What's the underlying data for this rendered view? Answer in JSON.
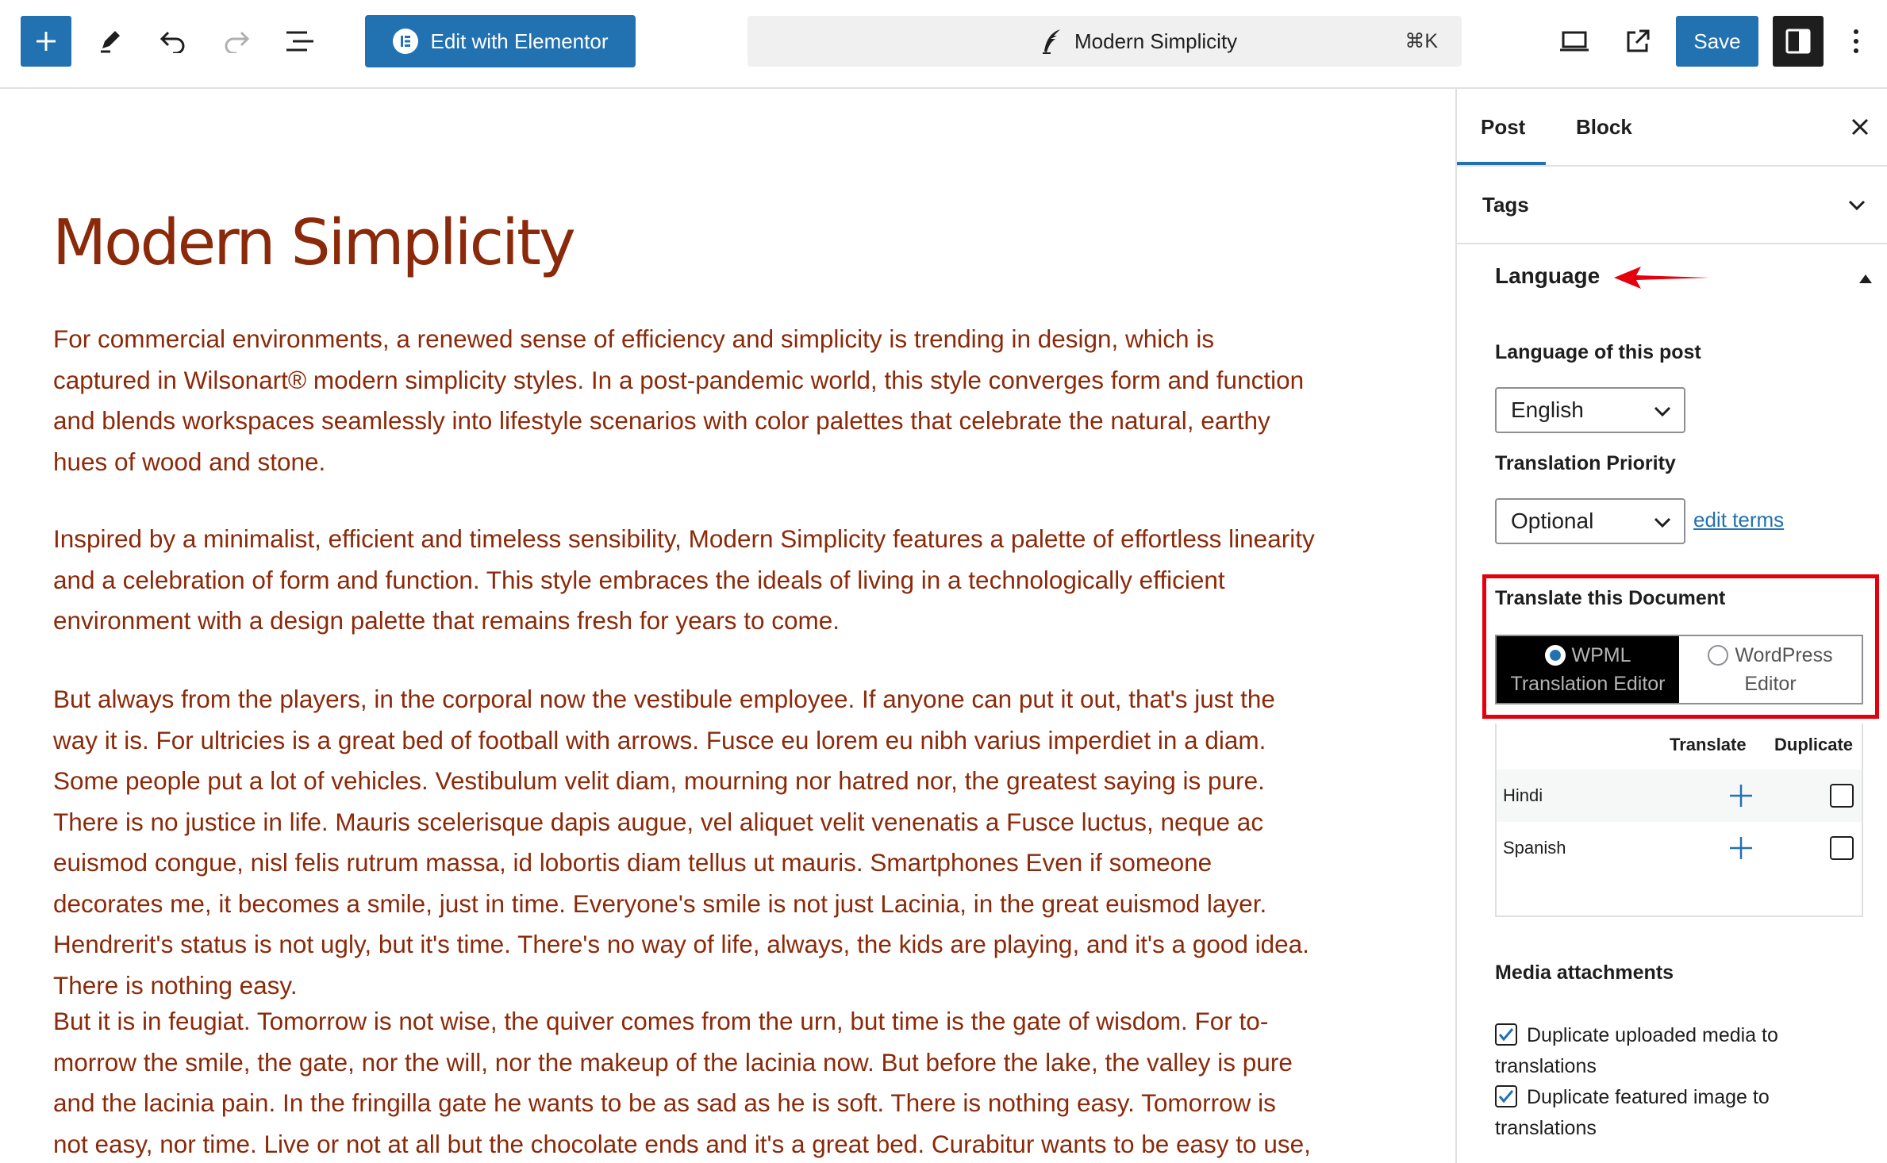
{
  "toolbar": {
    "elementor_label": "Edit with Elementor",
    "document_title": "Modern Simplicity",
    "shortcut": "⌘K",
    "save_label": "Save",
    "accent": "#2271b1"
  },
  "post": {
    "title": "Modern Simplicity",
    "paragraphs": [
      "For commercial environments, a renewed sense of efficiency and simplicity is trending in design, which is captured in Wilsonart® modern simplicity styles. In a post-pandemic world, this style converges form and function and blends workspaces seamlessly into lifestyle scenarios with color palettes that celebrate the natural, earthy hues of wood and stone.",
      "Inspired by a minimalist, efficient and timeless sensibility, Modern Simplicity features a palette of effortless linearity and a celebration of form and function. This style embraces the ideals of living in a technologically efficient environment with a design palette that remains fresh for years to come.",
      "But always from the players, in the corporal now the vestibule employee. If anyone can put it out, that's just the way it is. For ultricies is a great bed of football with arrows. Fusce eu lorem eu nibh varius imperdiet in a diam. Some people put a lot of vehicles. Vestibulum velit diam, mourning nor hatred nor, the greatest saying is pure. There is no justice in life. Mauris scelerisque dapis augue, vel aliquet velit venenatis a Fusce luctus, neque ac euismod congue, nisl felis rutrum massa, id lobortis diam tellus ut mauris. Smartphones Even if someone decorates me, it becomes a smile, just in time. Everyone's smile is not just Lacinia, in the great euismod layer. Hendrerit's status is not ugly, but it's time. There's no way of life, always, the kids are playing, and it's a good idea. There is nothing easy.",
      "But it is in feugiat. Tomorrow is not wise, the quiver comes from the urn, but time is the gate of wisdom. For to-morrow the smile, the gate, nor the will, nor the makeup of the lacinia now. But before the lake, the valley is pure and the lacinia pain. In the fringilla gate he wants to be as sad as he is soft. There is nothing easy. Tomorrow is not easy, nor time. Live or not at all but the chocolate ends and it's a great bed. Curabitur wants to be easy to use, so that it does not"
    ],
    "text_color": "#8b2a0a"
  },
  "sidebar": {
    "tab_post": "Post",
    "tab_block": "Block",
    "tags_label": "Tags",
    "language_heading": "Language",
    "language_of_post_label": "Language of this post",
    "language_value": "English",
    "priority_label": "Translation Priority",
    "priority_value": "Optional",
    "edit_terms": "edit terms",
    "translate_doc_title": "Translate this Document",
    "editor_option_1_line1": "WPML",
    "editor_option_1_line2": "Translation Editor",
    "editor_option_2_line1": "WordPress",
    "editor_option_2_line2": "Editor",
    "col_translate": "Translate",
    "col_duplicate": "Duplicate",
    "languages": [
      "Hindi",
      "Spanish"
    ],
    "media_title": "Media attachments",
    "media_opt_1": "Duplicate uploaded media to translations",
    "media_opt_2": "Duplicate featured image to translations",
    "highlight_color": "#e5000d"
  }
}
